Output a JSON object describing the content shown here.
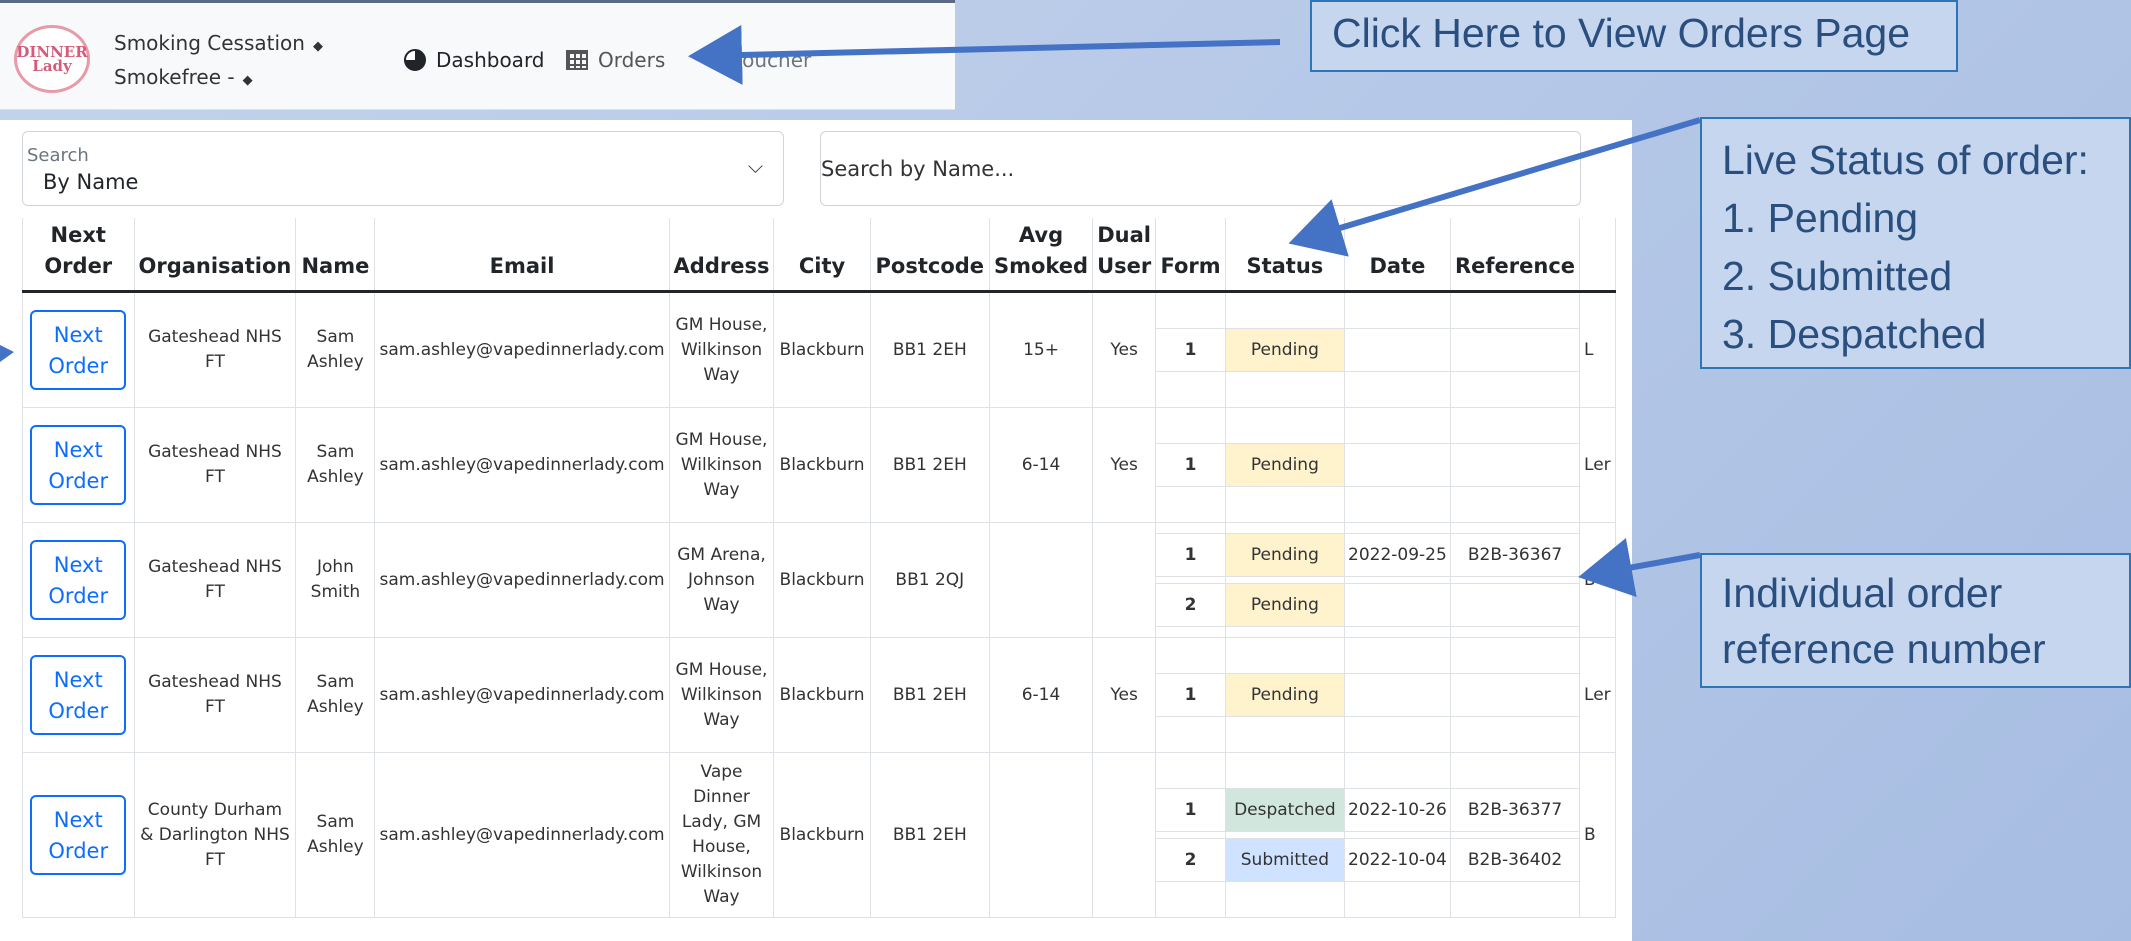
{
  "nav": {
    "program_select": "Smoking Cessation",
    "service_select": "Smokefree -",
    "links": {
      "dashboard": "Dashboard",
      "orders": "Orders",
      "voucher": "Voucher"
    },
    "logo_text": "DINNER Lady"
  },
  "search": {
    "select_label": "Search",
    "select_value": "By Name",
    "input_placeholder": "Search by Name..."
  },
  "table": {
    "headers": [
      "Next Order",
      "Organisation",
      "Name",
      "Email",
      "Address",
      "City",
      "Postcode",
      "Avg Smoked",
      "Dual User",
      "Form",
      "Status",
      "Date",
      "Reference"
    ],
    "rows": [
      {
        "next": "Next Order",
        "org": "Gateshead NHS FT",
        "name": "Sam Ashley",
        "email": "sam.ashley@vapedinnerlady.com",
        "address": "GM House, Wilkinson Way",
        "city": "Blackburn",
        "postcode": "BB1 2EH",
        "avg": "15+",
        "dual": "Yes",
        "forms": [
          {
            "form": "1",
            "status": "Pending",
            "date": "",
            "reference": ""
          }
        ],
        "overflow": "L"
      },
      {
        "next": "Next Order",
        "org": "Gateshead NHS FT",
        "name": "Sam Ashley",
        "email": "sam.ashley@vapedinnerlady.com",
        "address": "GM House, Wilkinson Way",
        "city": "Blackburn",
        "postcode": "BB1 2EH",
        "avg": "6-14",
        "dual": "Yes",
        "forms": [
          {
            "form": "1",
            "status": "Pending",
            "date": "",
            "reference": ""
          }
        ],
        "overflow": "Ler"
      },
      {
        "next": "Next Order",
        "org": "Gateshead NHS FT",
        "name": "John Smith",
        "email": "sam.ashley@vapedinnerlady.com",
        "address": "GM Arena, Johnson Way",
        "city": "Blackburn",
        "postcode": "BB1 2QJ",
        "avg": "",
        "dual": "",
        "forms": [
          {
            "form": "1",
            "status": "Pending",
            "date": "2022-09-25",
            "reference": "B2B-36367"
          },
          {
            "form": "2",
            "status": "Pending",
            "date": "",
            "reference": ""
          }
        ],
        "overflow": "B"
      },
      {
        "next": "Next Order",
        "org": "Gateshead NHS FT",
        "name": "Sam Ashley",
        "email": "sam.ashley@vapedinnerlady.com",
        "address": "GM House, Wilkinson Way",
        "city": "Blackburn",
        "postcode": "BB1 2EH",
        "avg": "6-14",
        "dual": "Yes",
        "forms": [
          {
            "form": "1",
            "status": "Pending",
            "date": "",
            "reference": ""
          }
        ],
        "overflow": "Ler"
      },
      {
        "next": "Next Order",
        "org": "County Durham & Darlington NHS FT",
        "name": "Sam Ashley",
        "email": "sam.ashley@vapedinnerlady.com",
        "address": "Vape Dinner Lady, GM House, Wilkinson Way",
        "city": "Blackburn",
        "postcode": "BB1 2EH",
        "avg": "",
        "dual": "",
        "forms": [
          {
            "form": "1",
            "status": "Despatched",
            "date": "2022-10-26",
            "reference": "B2B-36377"
          },
          {
            "form": "2",
            "status": "Submitted",
            "date": "2022-10-04",
            "reference": "B2B-36402"
          }
        ],
        "overflow": "B"
      }
    ]
  },
  "callouts": {
    "orders_page": "Click Here to View Orders Page",
    "status_title": "Live Status of order:",
    "status_items": [
      "1. Pending",
      "2. Submitted",
      "3. Despatched"
    ],
    "reference_line1": "Individual order",
    "reference_line2": "reference number"
  },
  "colors": {
    "pending": "#fff3cd",
    "despatched": "#d1e7dd",
    "submitted": "#cfe2ff",
    "button": "#0d6efd",
    "callout_border": "#2e75b6",
    "callout_arrow": "#4472c4"
  }
}
